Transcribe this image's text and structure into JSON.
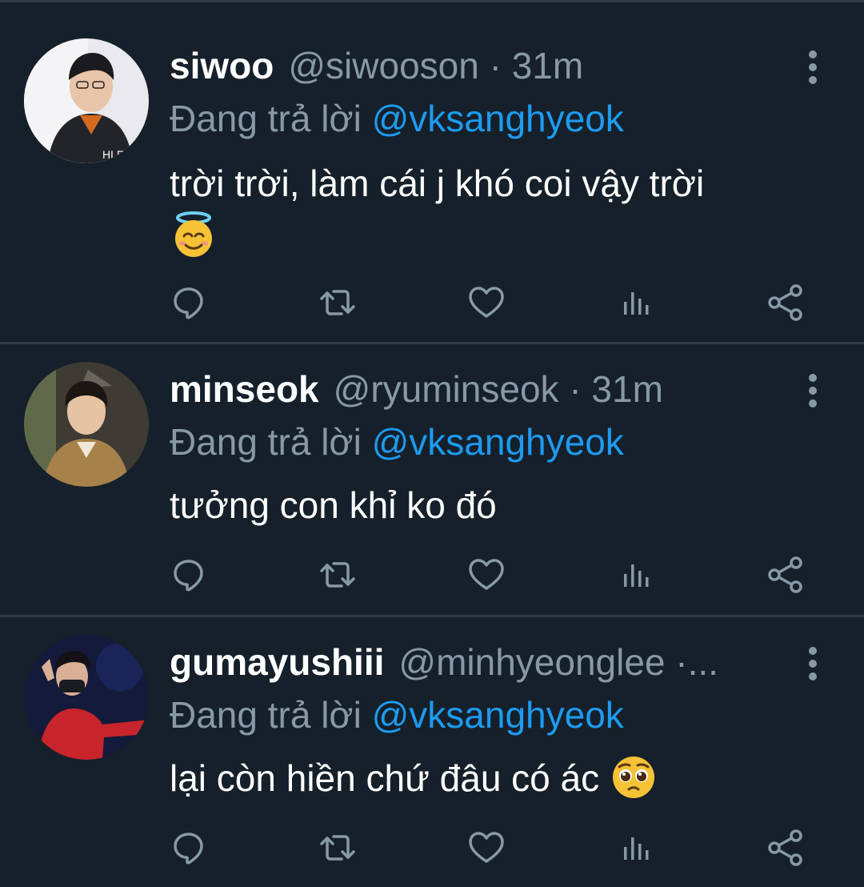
{
  "colors": {
    "background": "#15202b",
    "divider": "#2f3b47",
    "primary_text": "#ffffff",
    "secondary_text": "#8899a6",
    "mention": "#1d9bf0"
  },
  "reply_prefix": "Đang trả lời",
  "tweets": [
    {
      "name": "siwoo",
      "handle": "@siwooson",
      "separator": "·",
      "time": "31m",
      "reply_to": "@vksanghyeok",
      "text": "trời trời, làm cái j khó coi vậy trời",
      "emoji": "smiling-face-with-halo"
    },
    {
      "name": "minseok",
      "handle": "@ryuminseok",
      "separator": "·",
      "time": "31m",
      "reply_to": "@vksanghyeok",
      "text": "tưởng con khỉ ko đó",
      "emoji": ""
    },
    {
      "name": "gumayushiii",
      "handle": "@minhyeonglee",
      "separator": "·...",
      "time": "",
      "reply_to": "@vksanghyeok",
      "text": "lại còn hiền chứ đâu có ác",
      "emoji": "pleading-face"
    }
  ],
  "icons": {
    "reply": "reply-icon",
    "retweet": "retweet-icon",
    "like": "heart-icon",
    "stats": "analytics-icon",
    "share": "share-icon",
    "more": "more-vertical-icon"
  }
}
